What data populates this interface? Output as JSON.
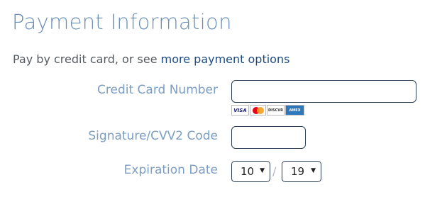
{
  "section": {
    "title": "Payment Information"
  },
  "intro": {
    "prefix": "Pay by credit card, or see ",
    "link": "more payment options"
  },
  "form": {
    "card_number": {
      "label": "Credit Card Number",
      "value": ""
    },
    "card_logos": [
      "visa-logo-icon",
      "mastercard-logo-icon",
      "discover-logo-icon",
      "amex-logo-icon"
    ],
    "cvv": {
      "label": "Signature/CVV2 Code",
      "value": ""
    },
    "expiration": {
      "label": "Expiration Date",
      "month": "10",
      "separator": "/",
      "year": "19"
    }
  }
}
